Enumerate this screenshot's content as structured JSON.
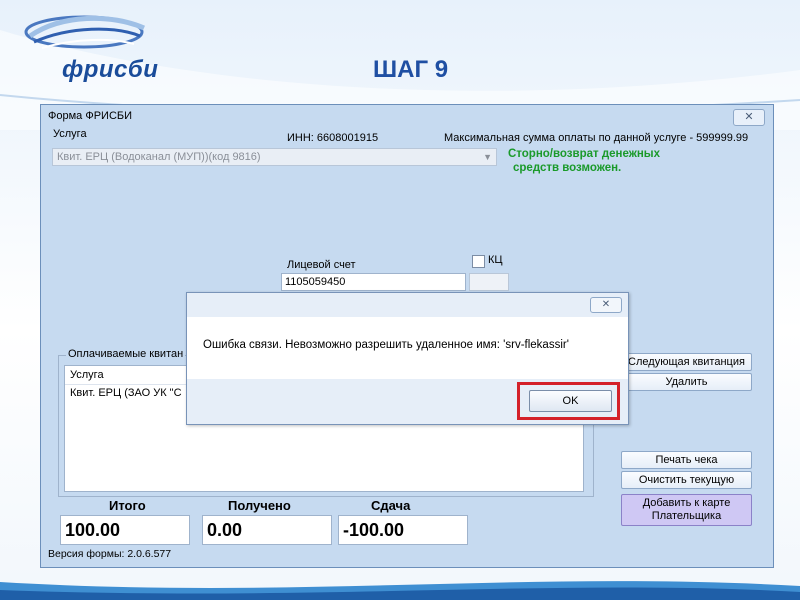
{
  "slide": {
    "logo_text": "фрисби",
    "step_title": "ШАГ 9"
  },
  "window": {
    "title": "Форма ФРИСБИ",
    "close_glyph": "✕",
    "service_label": "Услуга",
    "inn_text": "ИНН: 6608001915",
    "max_amount_text": "Максимальная сумма оплаты по данной услуге - 599999.99",
    "service_value": "Квит. ЕРЦ (Водоканал (МУП))(код 9816)",
    "storno_line1": "Сторно/возврат денежных",
    "storno_line2": "средств возможен.",
    "account_label": "Лицевой счет",
    "account_value": "1105059450",
    "kc_label": "КЦ",
    "receipts_legend": "Оплачиваемые квитан",
    "receipts_header": "Услуга",
    "receipts_row": "Квит. ЕРЦ (ЗАО УК \"С",
    "buttons": {
      "next_receipt": "Следующая квитанция",
      "delete": "Удалить",
      "print_check": "Печать чека",
      "clear_current": "Очистить текущую",
      "add_to_card_line1": "Добавить к карте",
      "add_to_card_line2": "Плательщика"
    },
    "totals": {
      "total_label": "Итого",
      "total_value": "100.00",
      "received_label": "Получено",
      "received_value": "0.00",
      "change_label": "Сдача",
      "change_value": "-100.00"
    },
    "version": "Версия формы: 2.0.6.577"
  },
  "dialog": {
    "close_glyph": "✕",
    "message": "Ошибка связи. Невозможно разрешить удаленное имя: 'srv-flekassir'",
    "ok_label": "OK"
  },
  "colors": {
    "window_bg": "#c6daf0",
    "green_note": "#1a9a2a",
    "highlight": "#d4212a",
    "add_button": "#cfc8f4",
    "title_blue": "#1f4fa3"
  }
}
